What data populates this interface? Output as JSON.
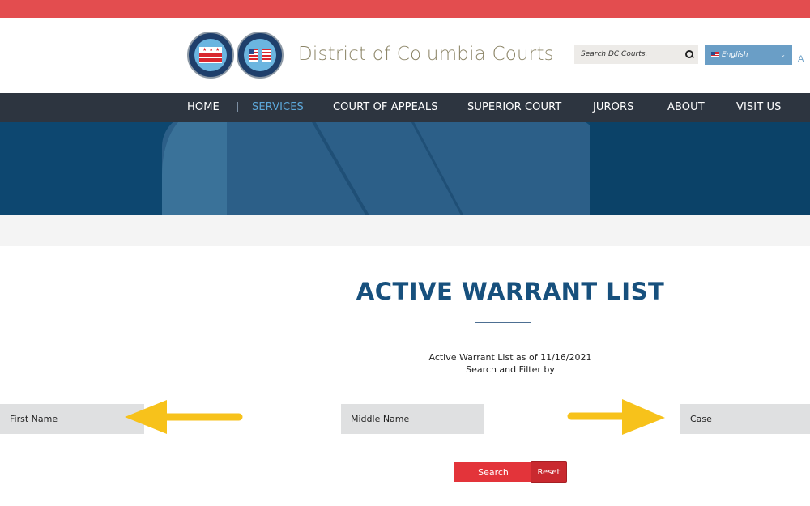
{
  "header": {
    "site_title": "District of Columbia Courts",
    "logos": [
      "court-of-appeals-seal",
      "superior-court-seal"
    ],
    "search": {
      "placeholder": "Search DC Courts.",
      "value": ""
    },
    "language": {
      "selected": "English"
    },
    "font_size_toggle": "A"
  },
  "nav": {
    "items": [
      {
        "label": "HOME",
        "active": false
      },
      {
        "label": "SERVICES",
        "active": true
      },
      {
        "label": "COURT OF APPEALS",
        "active": false
      },
      {
        "label": "SUPERIOR COURT",
        "active": false
      },
      {
        "label": "JURORS",
        "active": false
      },
      {
        "label": "ABOUT",
        "active": false
      },
      {
        "label": "VISIT US",
        "active": false
      }
    ]
  },
  "main": {
    "title": "ACTIVE WARRANT LIST",
    "as_of": "Active Warrant List as of 11/16/2021",
    "filter_label": "Search and Filter by",
    "fields": {
      "first_name": {
        "placeholder": "First Name",
        "value": ""
      },
      "middle_name": {
        "placeholder": "Middle Name",
        "value": ""
      },
      "case": {
        "placeholder": "Case",
        "value": ""
      }
    },
    "buttons": {
      "search": "Search",
      "reset": "Reset"
    }
  },
  "annotations": {
    "arrow_color": "#f7c21b",
    "arrows": [
      "pointing-left-to-first-name",
      "pointing-right-to-case"
    ]
  },
  "colors": {
    "top_bar": "#e34d4f",
    "nav_bg": "#2d3540",
    "nav_active": "#5da8da",
    "title": "#17507d",
    "button_red": "#e3343a"
  }
}
